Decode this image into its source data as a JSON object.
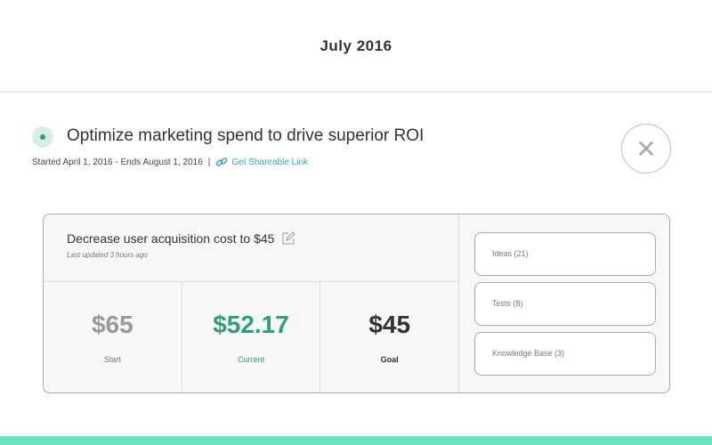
{
  "header": {
    "title": "July 2016"
  },
  "objective": {
    "title": "Optimize marketing spend to drive superior ROI",
    "dates": "Started April 1, 2016 - Ends August 1, 2016",
    "separator": "|",
    "share_link": "Get Shareable Link",
    "close": "✕"
  },
  "key_result": {
    "title": "Decrease user acquisition cost to $45",
    "updated": "Last updated 3 hours ago",
    "start": {
      "value": "$65",
      "label": "Start"
    },
    "current": {
      "value": "$52.17",
      "label": "Current"
    },
    "goal": {
      "value": "$45",
      "label": "Goal"
    }
  },
  "links": [
    {
      "label": "Ideas (21)"
    },
    {
      "label": "Tests (8)"
    },
    {
      "label": "Knowledge Base (3)"
    }
  ],
  "colors": {
    "accent": "#2e9e7d",
    "link": "#3aa6b3",
    "bar": "#6ee3c4"
  }
}
